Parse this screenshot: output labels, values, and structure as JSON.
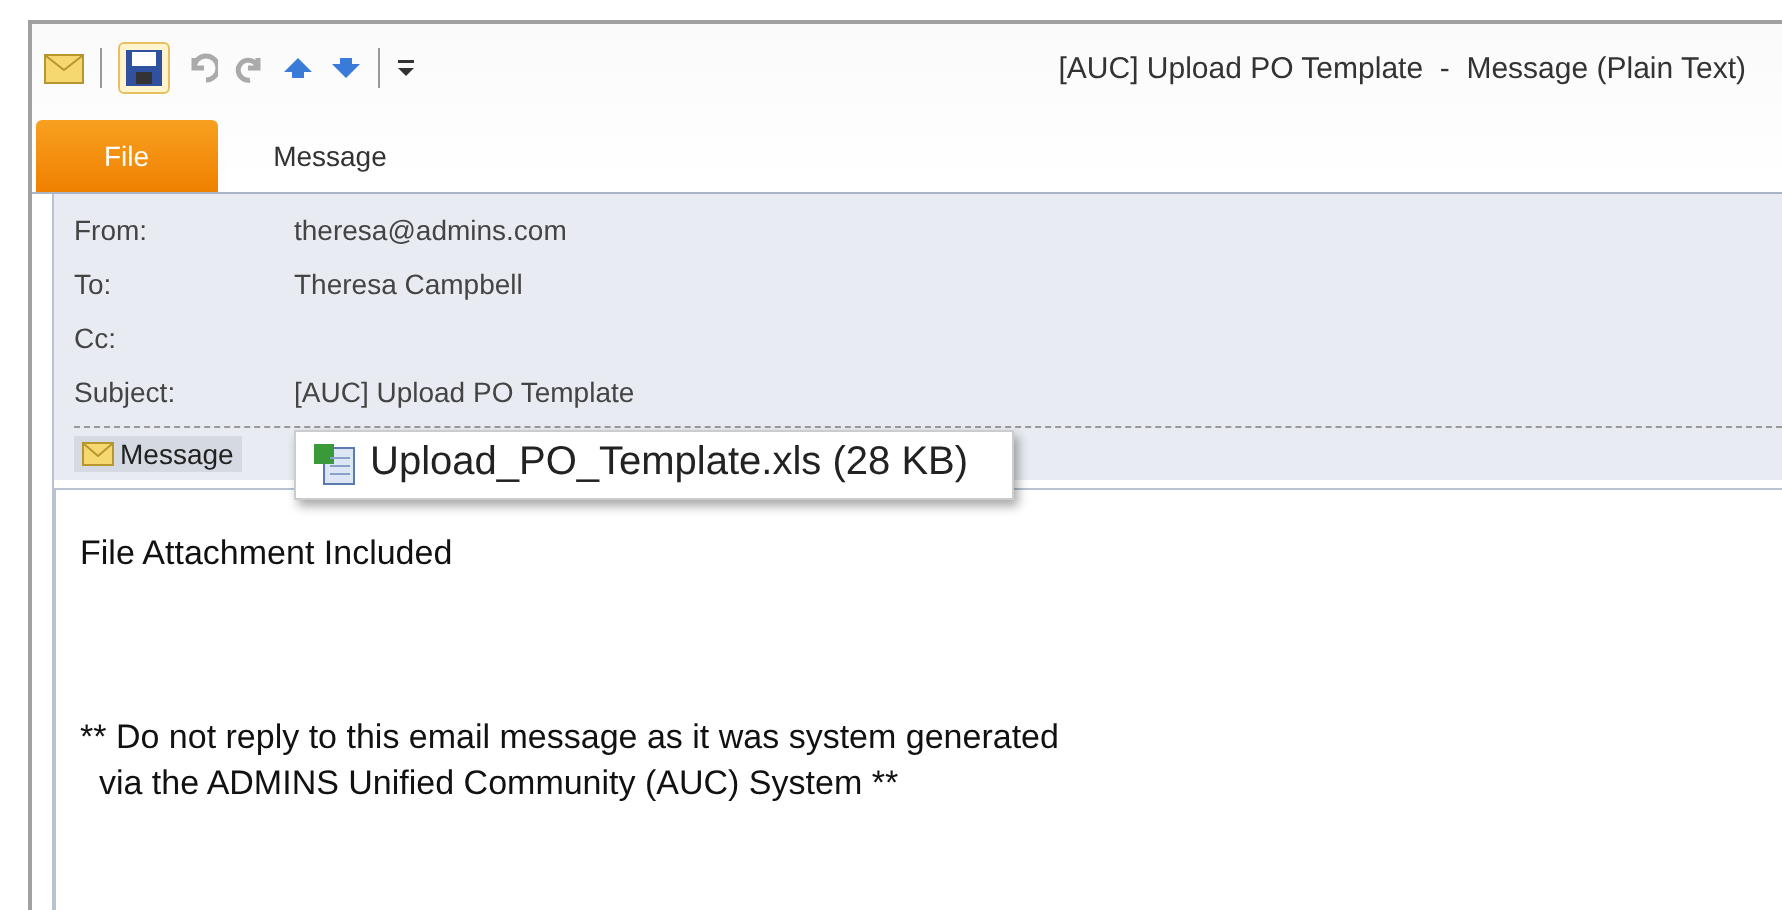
{
  "window": {
    "title": "[AUC] Upload PO Template  -  Message (Plain Text)"
  },
  "tabs": [
    {
      "label": "File",
      "selected": true
    },
    {
      "label": "Message",
      "selected": false
    }
  ],
  "header": {
    "fields": [
      {
        "label": "From:",
        "value": "theresa@admins.com"
      },
      {
        "label": "To:",
        "value": "Theresa Campbell"
      },
      {
        "label": "Cc:"
      },
      {
        "label": "Subject:",
        "value": "[AUC] Upload PO Template"
      }
    ]
  },
  "attachment_bar": {
    "message_tab": "Message",
    "popup": "Upload_PO_Template.xls (28 KB)"
  },
  "body": {
    "paragraphs": [
      [
        "File Attachment Included"
      ],
      [
        "** Do not reply to this email message as it was system generated",
        "  via the ADMINS Unified Community (AUC) System **"
      ]
    ]
  }
}
